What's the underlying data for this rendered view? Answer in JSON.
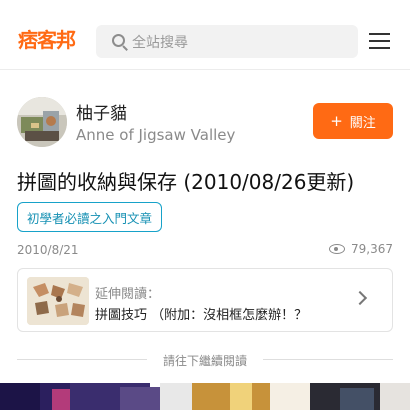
{
  "header": {
    "logo": "痞客邦",
    "search_placeholder": "全站搜尋",
    "search_icon": "search-icon",
    "menu_icon": "hamburger-menu-icon"
  },
  "author": {
    "name": "柚子貓",
    "subtitle": "Anne of Jigsaw Valley",
    "follow_label": "關注",
    "follow_icon": "+"
  },
  "article": {
    "title": "拼圖的收納與保存 (2010/08/26更新)",
    "tag": "初學者必讀之入門文章",
    "date": "2010/8/21",
    "views": "79,367"
  },
  "related": {
    "label": "延伸閱讀：",
    "title": "拼圖技巧 （附加：沒相框怎麼辦！？"
  },
  "continue_text": "請往下繼續閱讀",
  "colors": {
    "brand": "#ff6a14",
    "tag": "#17a2c9"
  }
}
